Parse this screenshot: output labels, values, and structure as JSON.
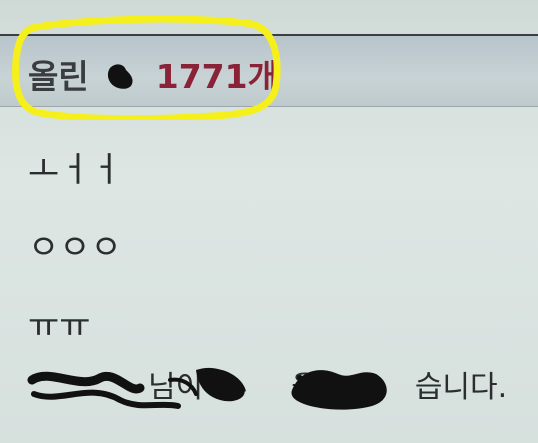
{
  "header": {
    "label": "올린",
    "count": "1771개"
  },
  "messages": [
    "ㅗㅓㅓ",
    "ㅇㅇㅇ",
    "ㅠㅠ"
  ],
  "footer_line": {
    "visible_fragment_1": "님이",
    "visible_fragment_2": "을",
    "visible_fragment_3": "습니다."
  },
  "colors": {
    "highlight": "#f5ef1c",
    "count_text": "#8a2238",
    "border": "#3b3f44"
  }
}
